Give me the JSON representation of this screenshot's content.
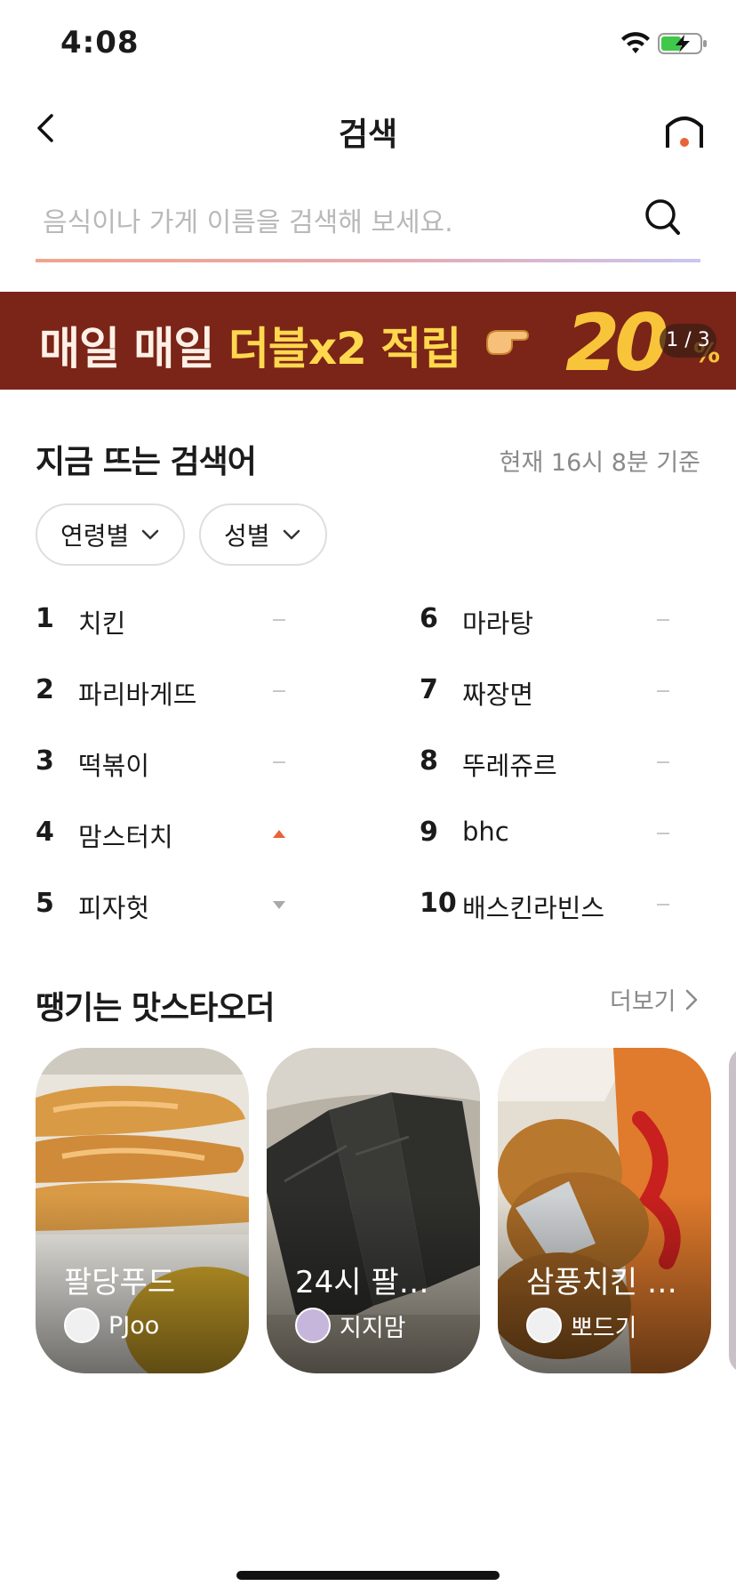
{
  "status_bar": {
    "time": "4:08"
  },
  "header": {
    "title": "검색"
  },
  "search": {
    "placeholder": "음식이나 가게 이름을 검색해 보세요."
  },
  "banner": {
    "text_part1": "매일 매일 ",
    "text_highlight": "더블x2 적립",
    "percent": "20",
    "percent_sign": "%",
    "pager": "1 / 3"
  },
  "trending": {
    "title": "지금 뜨는 검색어",
    "timestamp": "현재 16시 8분 기준",
    "filters": [
      {
        "label": "연령별"
      },
      {
        "label": "성별"
      }
    ],
    "items": [
      {
        "rank": "1",
        "label": "치킨",
        "change": "same"
      },
      {
        "rank": "2",
        "label": "파리바게뜨",
        "change": "same"
      },
      {
        "rank": "3",
        "label": "떡볶이",
        "change": "same"
      },
      {
        "rank": "4",
        "label": "맘스터치",
        "change": "up"
      },
      {
        "rank": "5",
        "label": "피자헛",
        "change": "down"
      },
      {
        "rank": "6",
        "label": "마라탕",
        "change": "same"
      },
      {
        "rank": "7",
        "label": "짜장면",
        "change": "same"
      },
      {
        "rank": "8",
        "label": "뚜레쥬르",
        "change": "same"
      },
      {
        "rank": "9",
        "label": "bhc",
        "change": "same"
      },
      {
        "rank": "10",
        "label": "배스킨라빈스",
        "change": "same"
      }
    ]
  },
  "matsta": {
    "title": "땡기는 맛스타오더",
    "more_label": "더보기",
    "cards": [
      {
        "title": "팔당푸드",
        "user": "PJoo"
      },
      {
        "title": "24시 팔…",
        "user": "지지맘"
      },
      {
        "title": "삼풍치킨 …",
        "user": "뽀드기"
      }
    ]
  },
  "colors": {
    "accent": "#e8633a",
    "banner_bg": "#7b2418",
    "banner_highlight": "#ffd84d",
    "muted": "#8a8a8a"
  }
}
